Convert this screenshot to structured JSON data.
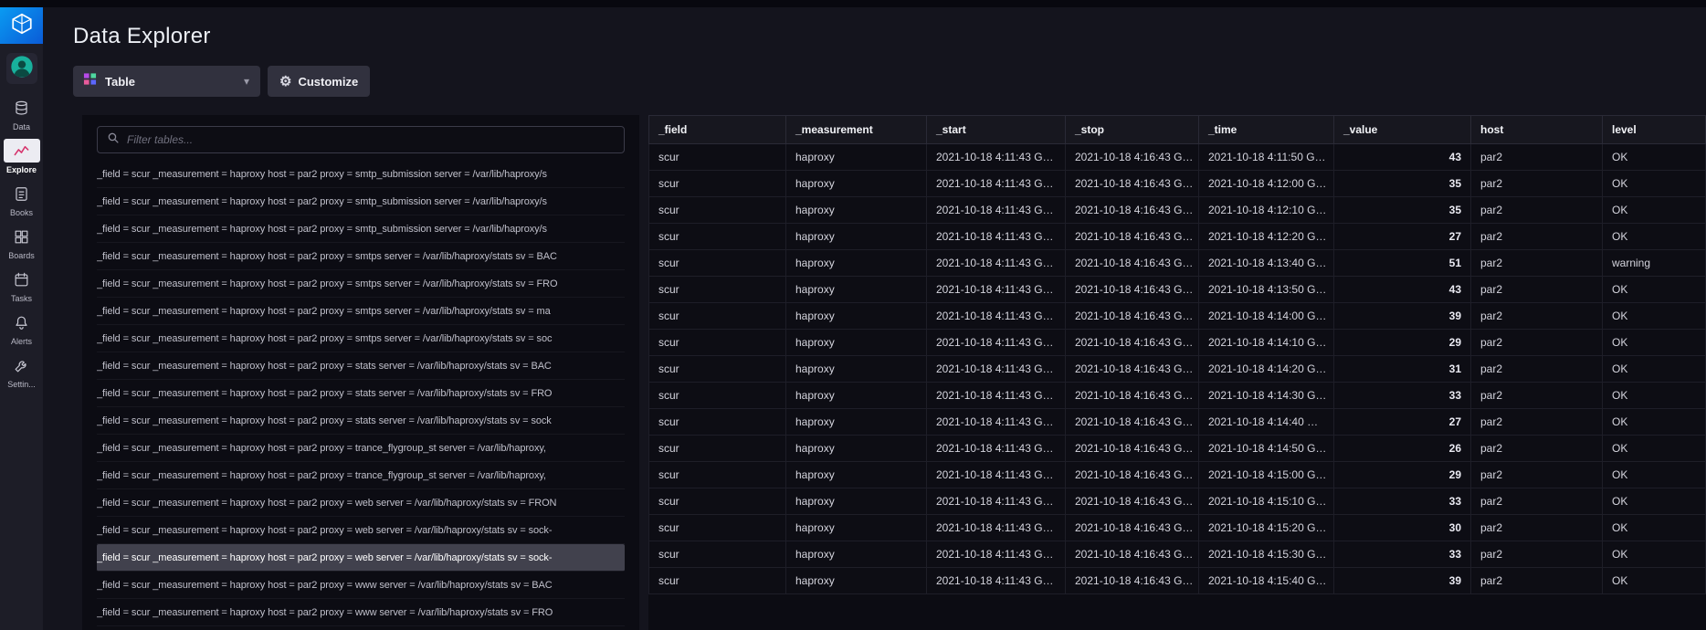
{
  "app": {
    "title": "Data Explorer"
  },
  "sidebar": {
    "items": [
      {
        "label": "Data"
      },
      {
        "label": "Explore",
        "active": true
      },
      {
        "label": "Books"
      },
      {
        "label": "Boards"
      },
      {
        "label": "Tasks"
      },
      {
        "label": "Alerts"
      },
      {
        "label": "Settin..."
      }
    ]
  },
  "toolbar": {
    "view_type_label": "Table",
    "customize_label": "Customize"
  },
  "left_panel": {
    "filter_placeholder": "Filter tables...",
    "selected_index": 14,
    "rows": [
      "_field = scur _measurement = haproxy host = par2 proxy = smtp_submission server = /var/lib/haproxy/s",
      "_field = scur _measurement = haproxy host = par2 proxy = smtp_submission server = /var/lib/haproxy/s",
      "_field = scur _measurement = haproxy host = par2 proxy = smtp_submission server = /var/lib/haproxy/s",
      "_field = scur _measurement = haproxy host = par2 proxy = smtps server = /var/lib/haproxy/stats sv = BAC",
      "_field = scur _measurement = haproxy host = par2 proxy = smtps server = /var/lib/haproxy/stats sv = FRO",
      "_field = scur _measurement = haproxy host = par2 proxy = smtps server = /var/lib/haproxy/stats sv = ma",
      "_field = scur _measurement = haproxy host = par2 proxy = smtps server = /var/lib/haproxy/stats sv = soc",
      "_field = scur _measurement = haproxy host = par2 proxy = stats server = /var/lib/haproxy/stats sv = BAC",
      "_field = scur _measurement = haproxy host = par2 proxy = stats server = /var/lib/haproxy/stats sv = FRO",
      "_field = scur _measurement = haproxy host = par2 proxy = stats server = /var/lib/haproxy/stats sv = sock",
      "_field = scur _measurement = haproxy host = par2 proxy = trance_flygroup_st server = /var/lib/haproxy,",
      "_field = scur _measurement = haproxy host = par2 proxy = trance_flygroup_st server = /var/lib/haproxy,",
      "_field = scur _measurement = haproxy host = par2 proxy = web server = /var/lib/haproxy/stats sv = FRON",
      "_field = scur _measurement = haproxy host = par2 proxy = web server = /var/lib/haproxy/stats sv = sock-",
      "_field = scur _measurement = haproxy host = par2 proxy = web server = /var/lib/haproxy/stats sv = sock-",
      "_field = scur _measurement = haproxy host = par2 proxy = www server = /var/lib/haproxy/stats sv = BAC",
      "_field = scur _measurement = haproxy host = par2 proxy = www server = /var/lib/haproxy/stats sv = FRO"
    ]
  },
  "table": {
    "columns": [
      "_field",
      "_measurement",
      "_start",
      "_stop",
      "_time",
      "_value",
      "host",
      "level"
    ],
    "rows": [
      [
        "scur",
        "haproxy",
        "2021-10-18 4:11:43 G…",
        "2021-10-18 4:16:43 G…",
        "2021-10-18 4:11:50 G…",
        "43",
        "par2",
        "OK"
      ],
      [
        "scur",
        "haproxy",
        "2021-10-18 4:11:43 G…",
        "2021-10-18 4:16:43 G…",
        "2021-10-18 4:12:00 G…",
        "35",
        "par2",
        "OK"
      ],
      [
        "scur",
        "haproxy",
        "2021-10-18 4:11:43 G…",
        "2021-10-18 4:16:43 G…",
        "2021-10-18 4:12:10 G…",
        "35",
        "par2",
        "OK"
      ],
      [
        "scur",
        "haproxy",
        "2021-10-18 4:11:43 G…",
        "2021-10-18 4:16:43 G…",
        "2021-10-18 4:12:20 G…",
        "27",
        "par2",
        "OK"
      ],
      [
        "scur",
        "haproxy",
        "2021-10-18 4:11:43 G…",
        "2021-10-18 4:16:43 G…",
        "2021-10-18 4:13:40 G…",
        "51",
        "par2",
        "warning"
      ],
      [
        "scur",
        "haproxy",
        "2021-10-18 4:11:43 G…",
        "2021-10-18 4:16:43 G…",
        "2021-10-18 4:13:50 G…",
        "43",
        "par2",
        "OK"
      ],
      [
        "scur",
        "haproxy",
        "2021-10-18 4:11:43 G…",
        "2021-10-18 4:16:43 G…",
        "2021-10-18 4:14:00 G…",
        "39",
        "par2",
        "OK"
      ],
      [
        "scur",
        "haproxy",
        "2021-10-18 4:11:43 G…",
        "2021-10-18 4:16:43 G…",
        "2021-10-18 4:14:10 G…",
        "29",
        "par2",
        "OK"
      ],
      [
        "scur",
        "haproxy",
        "2021-10-18 4:11:43 G…",
        "2021-10-18 4:16:43 G…",
        "2021-10-18 4:14:20 G…",
        "31",
        "par2",
        "OK"
      ],
      [
        "scur",
        "haproxy",
        "2021-10-18 4:11:43 G…",
        "2021-10-18 4:16:43 G…",
        "2021-10-18 4:14:30 G…",
        "33",
        "par2",
        "OK"
      ],
      [
        "scur",
        "haproxy",
        "2021-10-18 4:11:43 G…",
        "2021-10-18 4:16:43 G…",
        "2021-10-18 4:14:40 …",
        "27",
        "par2",
        "OK"
      ],
      [
        "scur",
        "haproxy",
        "2021-10-18 4:11:43 G…",
        "2021-10-18 4:16:43 G…",
        "2021-10-18 4:14:50 G…",
        "26",
        "par2",
        "OK"
      ],
      [
        "scur",
        "haproxy",
        "2021-10-18 4:11:43 G…",
        "2021-10-18 4:16:43 G…",
        "2021-10-18 4:15:00 G…",
        "29",
        "par2",
        "OK"
      ],
      [
        "scur",
        "haproxy",
        "2021-10-18 4:11:43 G…",
        "2021-10-18 4:16:43 G…",
        "2021-10-18 4:15:10 G…",
        "33",
        "par2",
        "OK"
      ],
      [
        "scur",
        "haproxy",
        "2021-10-18 4:11:43 G…",
        "2021-10-18 4:16:43 G…",
        "2021-10-18 4:15:20 G…",
        "30",
        "par2",
        "OK"
      ],
      [
        "scur",
        "haproxy",
        "2021-10-18 4:11:43 G…",
        "2021-10-18 4:16:43 G…",
        "2021-10-18 4:15:30 G…",
        "33",
        "par2",
        "OK"
      ],
      [
        "scur",
        "haproxy",
        "2021-10-18 4:11:43 G…",
        "2021-10-18 4:16:43 G…",
        "2021-10-18 4:15:40 G…",
        "39",
        "par2",
        "OK"
      ]
    ]
  },
  "colors": {
    "logo_blue": "#0a6bd8",
    "active_icon_pink": "#d6336c",
    "selected_row_bg": "#41414d",
    "panel_bg": "#0c0c13"
  }
}
